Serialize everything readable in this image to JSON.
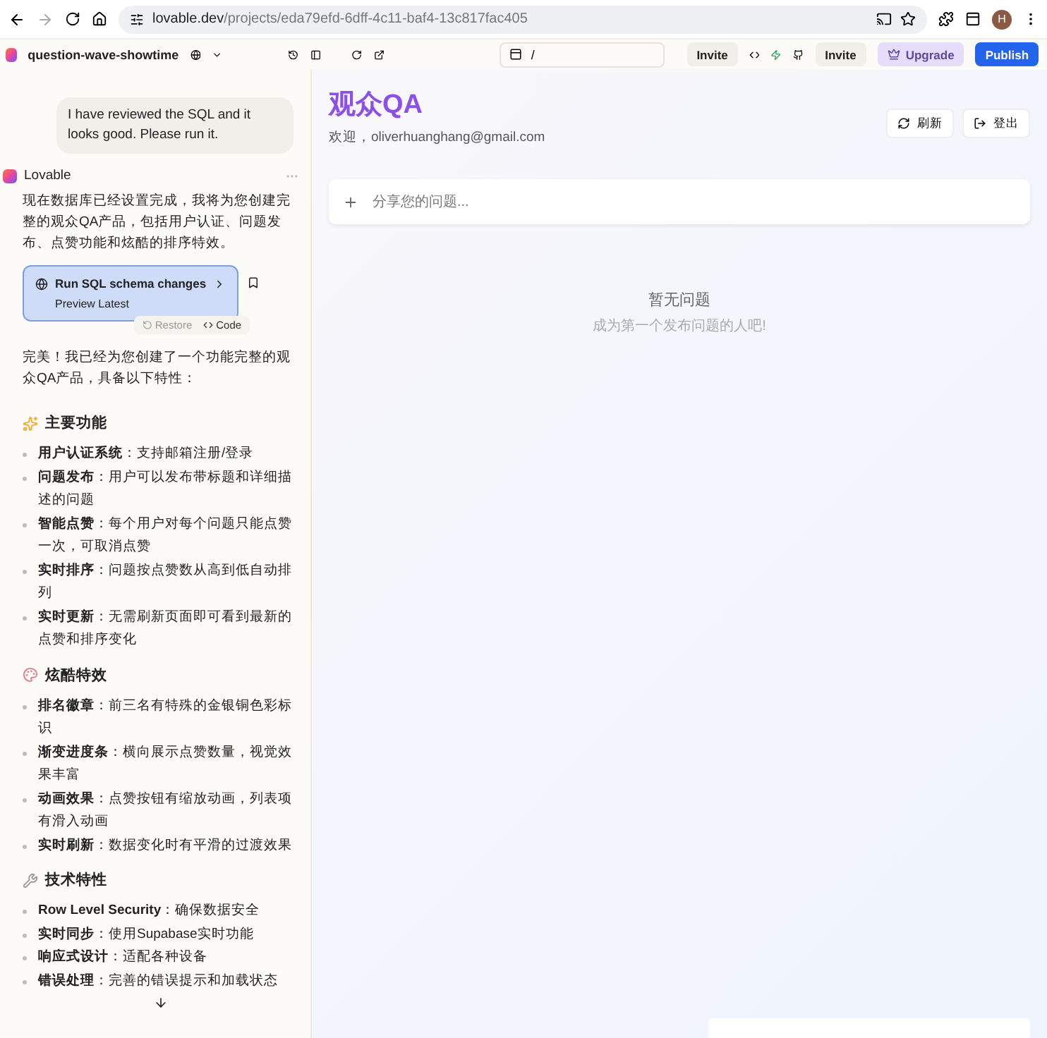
{
  "browser": {
    "url_host": "lovable.dev",
    "url_path": "/projects/eda79efd-6dff-4c11-baf4-13c817fac405",
    "avatar": "H"
  },
  "toolbar": {
    "project": "question-wave-showtime",
    "path": "/",
    "buttons": [
      {
        "label": "Invite",
        "kind": "plain"
      },
      {
        "label": "Invite",
        "kind": "plain"
      },
      {
        "label": "Upgrade",
        "kind": "upgrade"
      },
      {
        "label": "Publish",
        "kind": "primary"
      }
    ]
  },
  "chat": {
    "user_message": "I have reviewed the SQL and it looks good. Please run it.",
    "assistant": "Lovable",
    "intro": "现在数据库已经设置完成，我将为您创建完整的观众QA产品，包括用户认证、问题发布、点赞功能和炫酷的排序特效。",
    "action_card": {
      "title": "Run SQL schema changes",
      "subtitle": "Preview Latest",
      "restore": "Restore",
      "code": "Code"
    },
    "summary": "完美！我已经为您创建了一个功能完整的观众QA产品，具备以下特性：",
    "sections": [
      {
        "heading": "主要功能",
        "kind": "sparkle",
        "items": [
          {
            "text": "**用户认证系统**：支持邮箱注册/登录"
          },
          {
            "text": "**问题发布**：用户可以发布带标题和详细描述的问题"
          },
          {
            "text": "**智能点赞**：每个用户对每个问题只能点赞一次，可取消点赞"
          },
          {
            "text": "**实时排序**：问题按点赞数从高到低自动排列"
          },
          {
            "text": "**实时更新**：无需刷新页面即可看到最新的点赞和排序变化"
          }
        ]
      },
      {
        "heading": "炫酷特效",
        "kind": "palette",
        "items": [
          {
            "text": "**排名徽章**：前三名有特殊的金银铜色彩标识"
          },
          {
            "text": "**渐变进度条**：横向展示点赞数量，视觉效果丰富"
          },
          {
            "text": "**动画效果**：点赞按钮有缩放动画，列表项有滑入动画"
          },
          {
            "text": "**实时刷新**：数据变化时有平滑的过渡效果"
          }
        ]
      },
      {
        "heading": "技术特性",
        "kind": "wrench",
        "items": [
          {
            "text": "**Row Level Security**：确保数据安全"
          },
          {
            "text": "**实时同步**：使用Supabase实时功能"
          },
          {
            "text": "**响应式设计**：适配各种设备"
          },
          {
            "text": "**错误处理**：完善的错误提示和加载状态"
          }
        ]
      }
    ]
  },
  "preview": {
    "title": "观众QA",
    "welcome": "欢迎，oliverhuanghang@gmail.com",
    "refresh": "刷新",
    "logout": "登出",
    "ask_placeholder": "分享您的问题...",
    "empty_title": "暂无问题",
    "empty_subtitle": "成为第一个发布问题的人吧!"
  }
}
